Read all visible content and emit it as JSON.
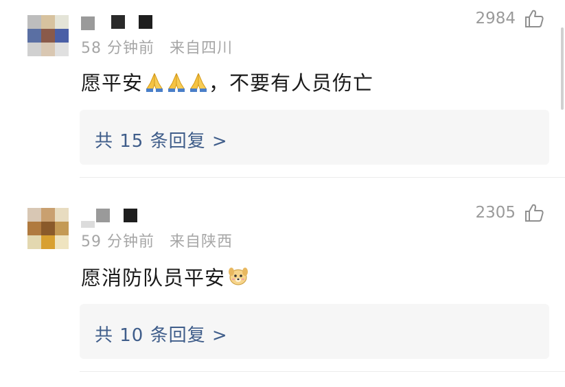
{
  "comments": [
    {
      "time": "58 分钟前",
      "location": "来自四川",
      "text_before": "愿平安",
      "text_after": "，不要有人员伤亡",
      "emoji_icons": [
        "folded-hands-icon",
        "folded-hands-icon",
        "folded-hands-icon"
      ],
      "likes": "2984",
      "replies_label": "共 15 条回复 >",
      "avatar_colors": [
        "#bdbdbd",
        "#d7c29f",
        "#e4e4d8",
        "#5a6fa3",
        "#8a5a4a",
        "#4a5fa6",
        "#d0d0d0",
        "#d9c7b2",
        "#e0e0e0"
      ]
    },
    {
      "time": "59 分钟前",
      "location": "来自陕西",
      "text_before": "愿消防队员平安",
      "text_after": "",
      "emoji_icons": [
        "dog-face-icon"
      ],
      "likes": "2305",
      "replies_label": "共 10 条回复 >",
      "avatar_colors": [
        "#d8c7b4",
        "#c9a070",
        "#e8dcc0",
        "#b07a3f",
        "#8a5a2a",
        "#c49a55",
        "#e3d8b0",
        "#d8a030",
        "#efe4c0"
      ]
    }
  ],
  "colors": {
    "reply_link": "#3f5d8a",
    "meta_gray": "#a6a6a6",
    "reply_background": "#f6f6f6"
  },
  "icons": {
    "like": "thumbs-up-outline-icon"
  }
}
